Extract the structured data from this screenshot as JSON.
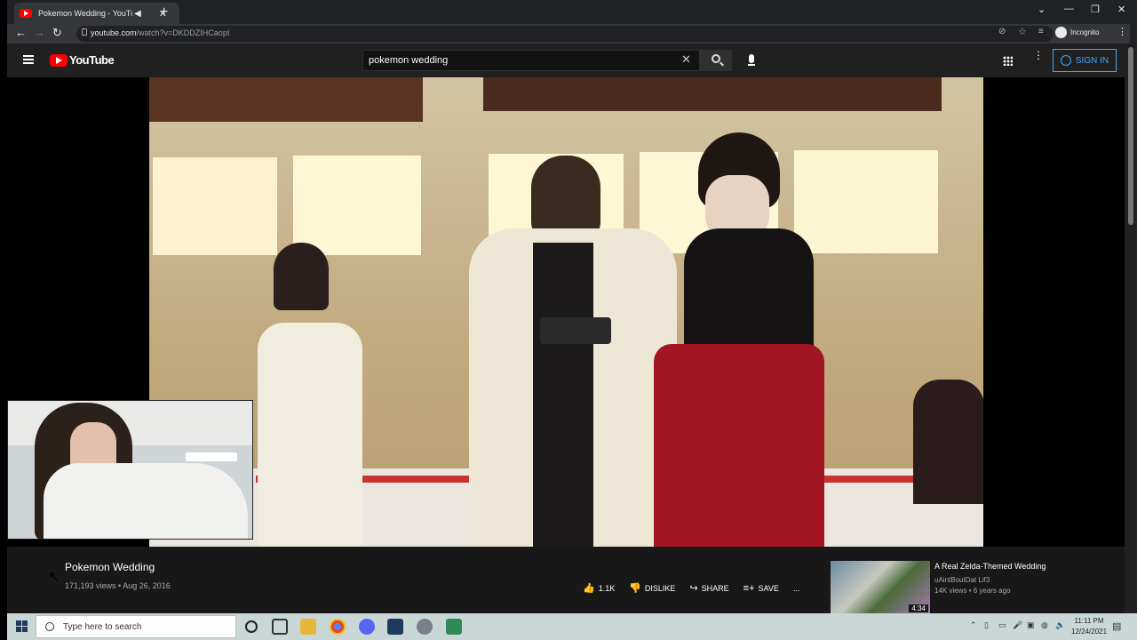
{
  "browser": {
    "tab_title": "Pokemon Wedding - YouTube",
    "url_host": "youtube.com",
    "url_path": "/watch?v=DKDDZIHCaopI",
    "incognito_label": "Incognito"
  },
  "youtube": {
    "logo_text": "YouTube",
    "search_value": "pokemon wedding",
    "sign_in_label": "SIGN IN"
  },
  "video": {
    "title": "Pokemon Wedding",
    "meta": "171,193 views • Aug 26, 2016",
    "likes": "1.1K",
    "dislike_label": "DISLIKE",
    "share_label": "SHARE",
    "save_label": "SAVE",
    "more_label": "..."
  },
  "recommended": {
    "title": "A Real Zelda-Themed Wedding",
    "channel": "uAintBoutDat Lif3",
    "views": "14K views • 6 years ago",
    "duration": "4:34"
  },
  "taskbar": {
    "search_placeholder": "Type here to search",
    "time": "11:11 PM",
    "date": "12/24/2021"
  },
  "colors": {
    "accent_blue": "#3ea6ff",
    "youtube_red": "#ff0000",
    "dark_bg": "#181818"
  }
}
